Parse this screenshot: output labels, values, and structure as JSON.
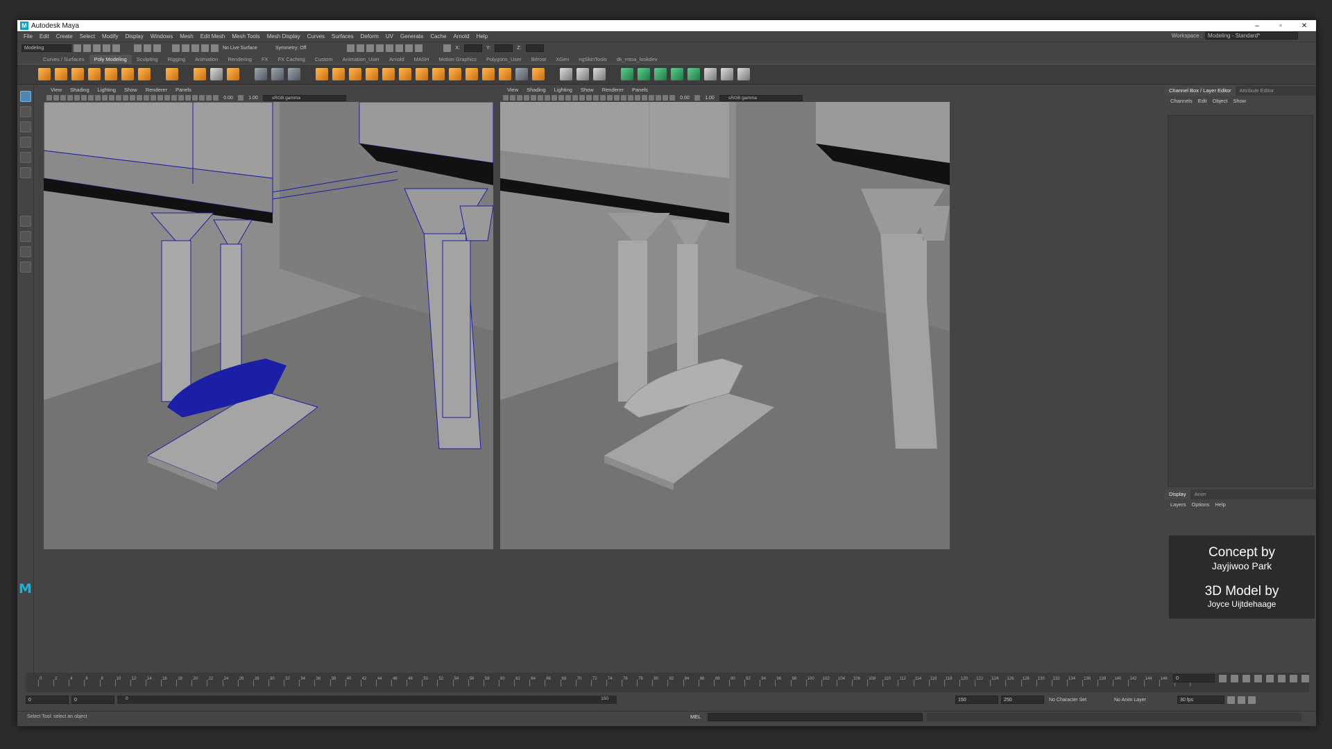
{
  "titlebar": {
    "title": "Autodesk Maya",
    "logo": "M",
    "minimize": "–",
    "maximize": "▫",
    "close": "✕"
  },
  "menus": [
    "File",
    "Edit",
    "Create",
    "Select",
    "Modify",
    "Display",
    "Windows",
    "Mesh",
    "Edit Mesh",
    "Mesh Tools",
    "Mesh Display",
    "Curves",
    "Surfaces",
    "Deform",
    "UV",
    "Generate",
    "Cache",
    "Arnold",
    "Help"
  ],
  "workspace": {
    "label": "Workspace :",
    "value": "Modeling - Standard*"
  },
  "statusline": {
    "mode": "Modeling",
    "live_surface": "No Live Surface",
    "symmetry": "Symmetry: Off",
    "x_label": "X:",
    "y_label": "Y:",
    "z_label": "Z:"
  },
  "shelf_tabs": [
    "Curves / Surfaces",
    "Poly Modeling",
    "Sculpting",
    "Rigging",
    "Animation",
    "Rendering",
    "FX",
    "FX Caching",
    "Custom",
    "Animation_User",
    "Arnold",
    "MASH",
    "Motion Graphics",
    "Polygons_User",
    "Bifrost",
    "XGen",
    "ngSkinTools",
    "dk_mtoa_lookdev"
  ],
  "shelf_active": "Poly Modeling",
  "viewport_left": {
    "menus": [
      "View",
      "Shading",
      "Lighting",
      "Show",
      "Renderer",
      "Panels"
    ],
    "exposure": "0.00",
    "gamma": "1.00",
    "color_space": "sRGB gamma"
  },
  "viewport_right": {
    "menus": [
      "View",
      "Shading",
      "Lighting",
      "Show",
      "Renderer",
      "Panels"
    ],
    "exposure": "0.00",
    "gamma": "1.00",
    "color_space": "sRGB gamma"
  },
  "right_panel": {
    "tabs": [
      "Channel Box / Layer Editor",
      "Attribute Editor"
    ],
    "sub_menus": [
      "Channels",
      "Edit",
      "Object",
      "Show"
    ],
    "layer_tabs": [
      "Display",
      "Anim"
    ],
    "layer_menus": [
      "Layers",
      "Options",
      "Help"
    ]
  },
  "credits": {
    "concept_label": "Concept by",
    "concept_name": "Jayjiwoo Park",
    "model_label": "3D Model by",
    "model_name": "Joyce Uijtdehaage"
  },
  "timeline": {
    "ticks": [
      "0",
      "2",
      "4",
      "6",
      "8",
      "10",
      "12",
      "14",
      "16",
      "18",
      "20",
      "22",
      "24",
      "26",
      "28",
      "30",
      "32",
      "34",
      "36",
      "38",
      "40",
      "42",
      "44",
      "46",
      "48",
      "50",
      "52",
      "54",
      "56",
      "58",
      "60",
      "62",
      "64",
      "66",
      "68",
      "70",
      "72",
      "74",
      "76",
      "78",
      "80",
      "82",
      "84",
      "86",
      "88",
      "90",
      "92",
      "94",
      "96",
      "98",
      "100",
      "102",
      "104",
      "106",
      "108",
      "110",
      "112",
      "114",
      "116",
      "118",
      "120",
      "122",
      "124",
      "126",
      "128",
      "130",
      "132",
      "134",
      "136",
      "138",
      "140",
      "142",
      "144",
      "146",
      "148",
      "150"
    ],
    "current_frame": "0"
  },
  "range": {
    "start": "0",
    "anim_start": "0",
    "slider_start": "0",
    "slider_end": "150",
    "end": "150",
    "anim_end": "250",
    "character_set": "No Character Set",
    "anim_layer": "No Anim Layer",
    "fps": "30 fps"
  },
  "commandline": {
    "help": "Select Tool: select an object",
    "mel": "MEL"
  },
  "colors": {
    "wire_blue": "#1b1fa6",
    "accent": "#4d87b8",
    "maya_cyan": "#17b4d8"
  }
}
